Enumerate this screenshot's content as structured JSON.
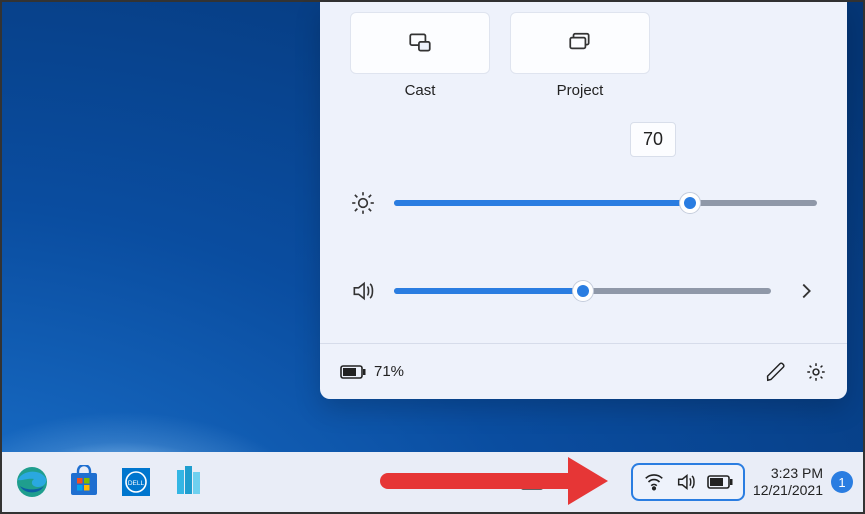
{
  "quick_settings": {
    "tiles": [
      {
        "label": "Cast",
        "icon": "cast-icon"
      },
      {
        "label": "Project",
        "icon": "project-icon"
      }
    ],
    "brightness": {
      "value": 70,
      "tooltip": "70"
    },
    "volume": {
      "value": 50
    },
    "battery_percent": "71%"
  },
  "taskbar": {
    "time": "3:23 PM",
    "date": "12/21/2021",
    "notifications": "1"
  },
  "colors": {
    "accent": "#2a7de1",
    "panel_bg": "#eef2fb",
    "arrow": "#e63636"
  }
}
